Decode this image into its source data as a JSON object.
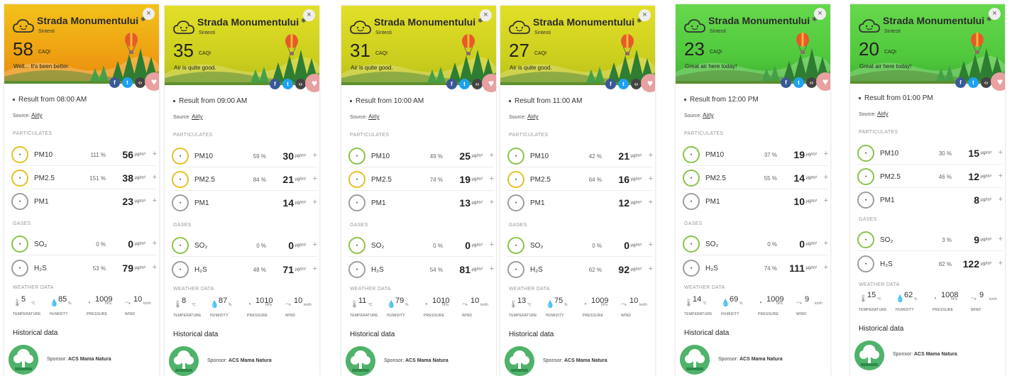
{
  "colors": {
    "orange_header": "#f0b21c",
    "yellow_header": "#d8d21e",
    "green_header": "#5fd04a",
    "ring_green": "#8bc34a",
    "ring_yellow": "#e2c227",
    "ring_gray": "#9e9e9e",
    "sponsor_green": "#4fb36b"
  },
  "icons": {
    "cloud": "cloud-face-icon",
    "balloon": "hot-air-balloon-icon",
    "close": "close-icon",
    "facebook": "facebook-icon",
    "twitter": "twitter-icon",
    "embed": "embed-icon",
    "heart": "heart-icon",
    "thermometer": "thermometer-icon",
    "humidity": "droplet-icon",
    "pressure": "gauge-icon",
    "wind": "wind-icon"
  },
  "labels": {
    "station": "Strada Monumentului",
    "city": "Sintesti",
    "caqi": "CAQI",
    "source_prefix": "Source:",
    "source_name": "Airly",
    "particulates": "PARTICULATES",
    "gases": "GASES",
    "weather": "WEATHER DATA",
    "temperature": "TEMPERATURE",
    "humidity": "HUMIDITY",
    "pressure": "PRESSURE",
    "wind": "WIND",
    "temp_unit": "°C",
    "humidity_unit": "%",
    "pressure_unit": "hPa",
    "wind_unit": "km/h",
    "pct_sign": "%",
    "unit": "µg/m³",
    "pm10": "PM10",
    "pm25": "PM2.5",
    "pm1": "PM1",
    "so2": "SO₂",
    "h2s": "H₂S",
    "historical": "Historical data",
    "sponsor_prefix": "Sponsor:",
    "sponsor_name": "ACS Mama Natura",
    "close": "×",
    "plus": "+"
  },
  "cards": [
    {
      "theme": "orange",
      "caqi": "58",
      "message": "Well... It's been better.",
      "result": "Result from 08:00 AM",
      "pm10": {
        "pct": "111",
        "val": "56",
        "ring": "yellow"
      },
      "pm25": {
        "pct": "151",
        "val": "38",
        "ring": "yellow"
      },
      "pm1": {
        "val": "23"
      },
      "so2": {
        "pct": "0",
        "val": "0"
      },
      "h2s": {
        "pct": "53",
        "val": "79"
      },
      "temp": "5",
      "humidity": "85",
      "pressure": "1009",
      "wind": "10"
    },
    {
      "theme": "yellow",
      "caqi": "35",
      "message": "Air is quite good.",
      "result": "Result from 09:00 AM",
      "pm10": {
        "pct": "59",
        "val": "30",
        "ring": "yellow"
      },
      "pm25": {
        "pct": "84",
        "val": "21",
        "ring": "yellow"
      },
      "pm1": {
        "val": "14"
      },
      "so2": {
        "pct": "0",
        "val": "0"
      },
      "h2s": {
        "pct": "48",
        "val": "71"
      },
      "temp": "8",
      "humidity": "87",
      "pressure": "1010",
      "wind": "10"
    },
    {
      "theme": "yellow",
      "caqi": "31",
      "message": "Air is quite good.",
      "result": "Result from 10:00 AM",
      "pm10": {
        "pct": "49",
        "val": "25",
        "ring": "green"
      },
      "pm25": {
        "pct": "74",
        "val": "19",
        "ring": "yellow"
      },
      "pm1": {
        "val": "13"
      },
      "so2": {
        "pct": "0",
        "val": "0"
      },
      "h2s": {
        "pct": "54",
        "val": "81"
      },
      "temp": "11",
      "humidity": "79",
      "pressure": "1010",
      "wind": "10"
    },
    {
      "theme": "yellow",
      "caqi": "27",
      "message": "Air is quite good.",
      "result": "Result from 11:00 AM",
      "pm10": {
        "pct": "42",
        "val": "21",
        "ring": "green"
      },
      "pm25": {
        "pct": "64",
        "val": "16",
        "ring": "yellow"
      },
      "pm1": {
        "val": "12"
      },
      "so2": {
        "pct": "0",
        "val": "0"
      },
      "h2s": {
        "pct": "62",
        "val": "92"
      },
      "temp": "13",
      "humidity": "75",
      "pressure": "1009",
      "wind": "10"
    },
    {
      "theme": "green",
      "caqi": "23",
      "message": "Great air here today!",
      "result": "Result from 12:00 PM",
      "pm10": {
        "pct": "37",
        "val": "19",
        "ring": "green"
      },
      "pm25": {
        "pct": "55",
        "val": "14",
        "ring": "green"
      },
      "pm1": {
        "val": "10"
      },
      "so2": {
        "pct": "0",
        "val": "0"
      },
      "h2s": {
        "pct": "74",
        "val": "111"
      },
      "temp": "14",
      "humidity": "69",
      "pressure": "1009",
      "wind": "9"
    },
    {
      "theme": "green",
      "caqi": "20",
      "message": "Great air here today!",
      "result": "Result from 01:00 PM",
      "pm10": {
        "pct": "30",
        "val": "15",
        "ring": "green"
      },
      "pm25": {
        "pct": "46",
        "val": "12",
        "ring": "green"
      },
      "pm1": {
        "val": "8"
      },
      "so2": {
        "pct": "3",
        "val": "9"
      },
      "h2s": {
        "pct": "82",
        "val": "122"
      },
      "temp": "15",
      "humidity": "62",
      "pressure": "1008",
      "wind": "9"
    }
  ]
}
